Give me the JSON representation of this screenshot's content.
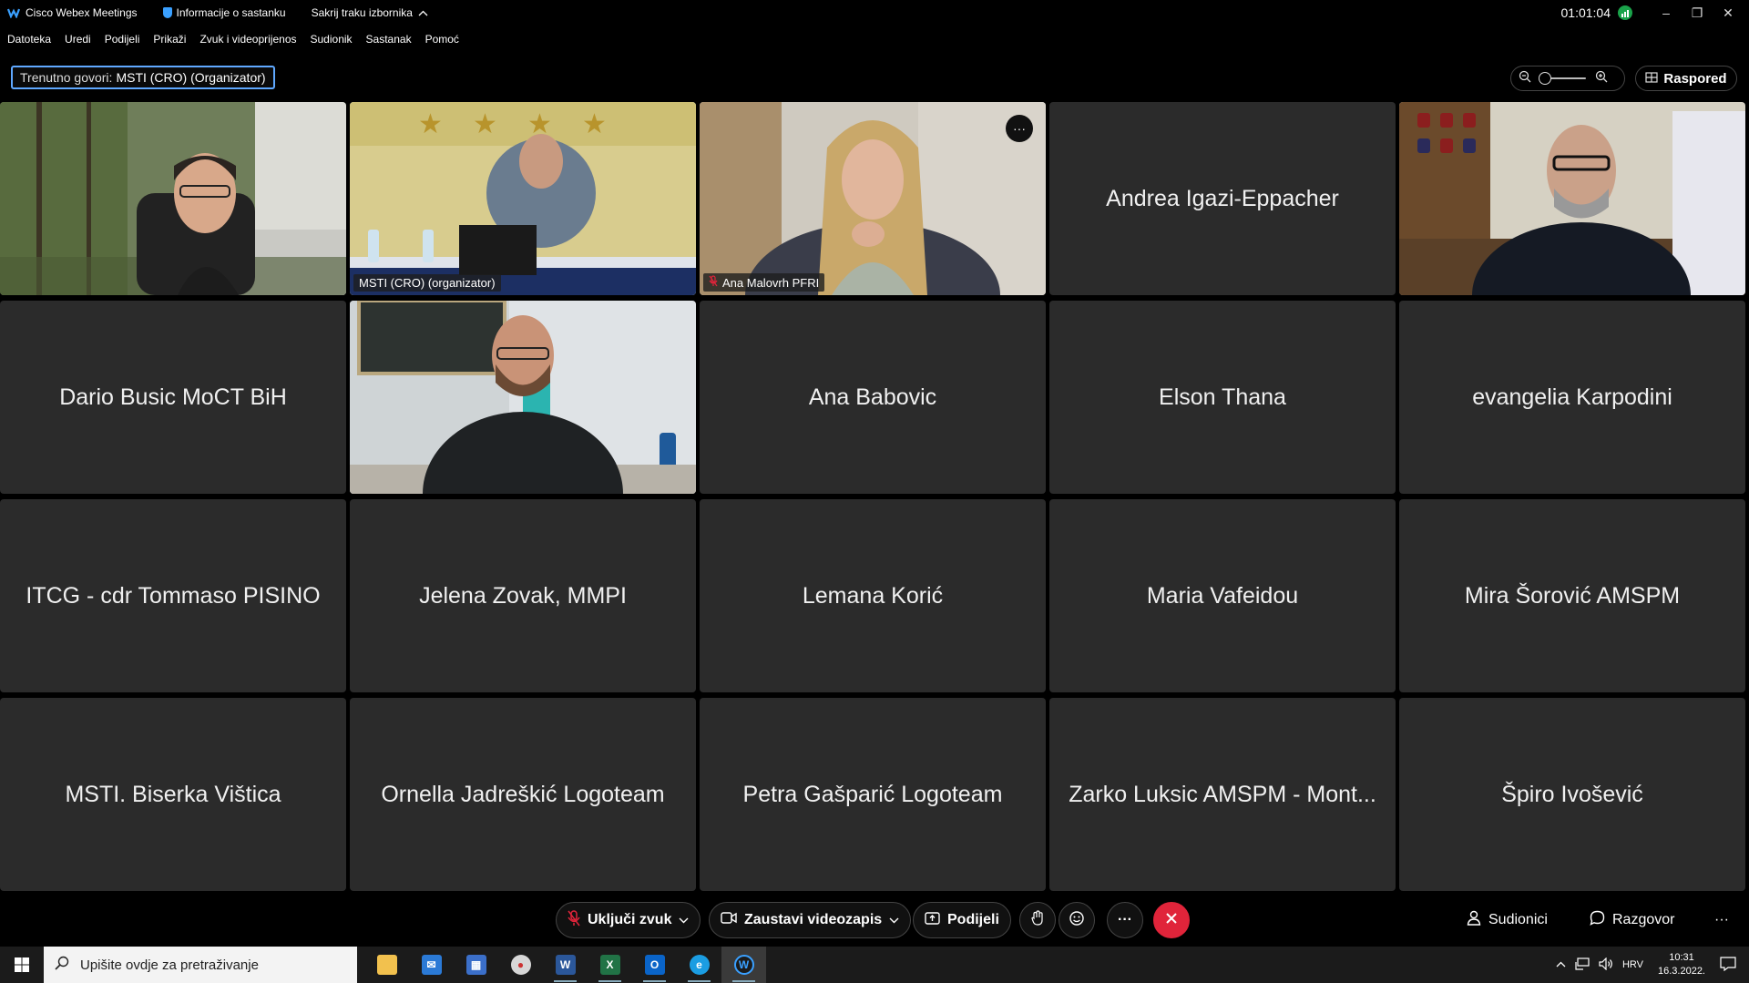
{
  "titlebar": {
    "app_name": "Cisco Webex Meetings",
    "meeting_info": "Informacije o sastanku",
    "hide_menu": "Sakrij traku izbornika",
    "timer": "01:01:04",
    "minimize": "–",
    "restore": "❐",
    "close": "✕"
  },
  "menu": {
    "items": [
      "Datoteka",
      "Uredi",
      "Podijeli",
      "Prikaži",
      "Zvuk i videoprijenos",
      "Sudionik",
      "Sastanak",
      "Pomoć"
    ]
  },
  "speaking": {
    "label": "Trenutno govori:",
    "name": "MSTI (CRO) (Organizator)"
  },
  "layout_button": "Raspored",
  "tiles": [
    {
      "name": "",
      "caption": ""
    },
    {
      "name": "",
      "caption": "MSTI (CRO) (organizator)"
    },
    {
      "name": "",
      "caption": "Ana Malovrh PFRI"
    },
    {
      "name": "Andrea Igazi-Eppacher",
      "caption": ""
    },
    {
      "name": "",
      "caption": ""
    },
    {
      "name": "Dario Busic MoCT BiH",
      "caption": ""
    },
    {
      "name": "",
      "caption": ""
    },
    {
      "name": "Ana Babovic",
      "caption": ""
    },
    {
      "name": "Elson Thana",
      "caption": ""
    },
    {
      "name": "evangelia Karpodini",
      "caption": ""
    },
    {
      "name": "ITCG - cdr Tommaso PISINO",
      "caption": ""
    },
    {
      "name": "Jelena Zovak, MMPI",
      "caption": ""
    },
    {
      "name": "Lemana Korić",
      "caption": ""
    },
    {
      "name": "Maria Vafeidou",
      "caption": ""
    },
    {
      "name": "Mira Šorović AMSPM",
      "caption": ""
    },
    {
      "name": "MSTI. Biserka Vištica",
      "caption": ""
    },
    {
      "name": "Ornella Jadreškić Logoteam",
      "caption": ""
    },
    {
      "name": "Petra Gašparić Logoteam",
      "caption": ""
    },
    {
      "name": "Zarko Luksic AMSPM - Mont...",
      "caption": ""
    },
    {
      "name": "Špiro Ivošević",
      "caption": ""
    }
  ],
  "controls": {
    "unmute": "Uključi zvuk",
    "stop_video": "Zaustavi videozapis",
    "share": "Podijeli",
    "participants": "Sudionici",
    "chat": "Razgovor",
    "more": "···"
  },
  "taskbar": {
    "search_placeholder": "Upišite ovdje za pretraživanje",
    "language": "HRV",
    "time": "10:31",
    "date": "16.3.2022."
  },
  "colors": {
    "accent": "#5fa8ff",
    "end_call": "#e0243a",
    "tile_bg": "#2b2b2b"
  }
}
